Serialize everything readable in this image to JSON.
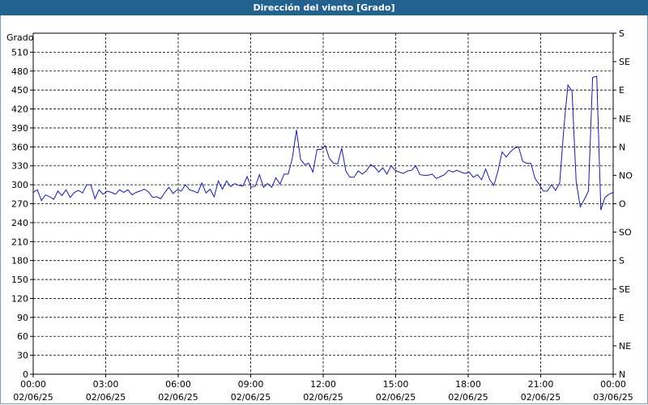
{
  "window": {
    "title": "Dirección del viento [Grado]"
  },
  "chart_data": {
    "type": "line",
    "title": "Dirección del viento [Grado]",
    "ylabel": "Grado",
    "ylim": [
      0,
      540
    ],
    "y_ticks": [
      0,
      30,
      60,
      90,
      120,
      150,
      180,
      210,
      240,
      270,
      300,
      330,
      360,
      390,
      420,
      450,
      480,
      510
    ],
    "right_axis_labels": [
      "N",
      "NE",
      "E",
      "SE",
      "S",
      "SO",
      "O",
      "NO",
      "N",
      "NE",
      "E",
      "SE",
      "S"
    ],
    "right_axis_values": [
      0,
      45,
      90,
      135,
      180,
      225,
      270,
      315,
      360,
      405,
      450,
      495,
      540
    ],
    "x_ticks": [
      {
        "time": "00:00",
        "date": "02/06/25"
      },
      {
        "time": "03:00",
        "date": "02/06/25"
      },
      {
        "time": "06:00",
        "date": "02/06/25"
      },
      {
        "time": "09:00",
        "date": "02/06/25"
      },
      {
        "time": "12:00",
        "date": "02/06/25"
      },
      {
        "time": "15:00",
        "date": "02/06/25"
      },
      {
        "time": "18:00",
        "date": "02/06/25"
      },
      {
        "time": "21:00",
        "date": "02/06/25"
      },
      {
        "time": "00:00",
        "date": "03/06/25"
      }
    ],
    "grid": true,
    "series": [
      {
        "color": "#1a1aaa",
        "x_hours": [
          0,
          0.2,
          0.4,
          0.6,
          0.8,
          1,
          1.2,
          1.4,
          1.6,
          1.8,
          2,
          2.1,
          2.3,
          2.5,
          2.7,
          2.9,
          3,
          3.2,
          3.4,
          3.6,
          3.8,
          4,
          4.2,
          4.4,
          4.6,
          4.8,
          5,
          5.2,
          5.4,
          5.6,
          5.8,
          6,
          6.2,
          6.4,
          6.6,
          6.8,
          7,
          7.2,
          7.4,
          7.6,
          7.8,
          8,
          8.2,
          8.4,
          8.6,
          8.8,
          9,
          9.2,
          9.4,
          9.6,
          9.8,
          10,
          10.2,
          10.4,
          10.6,
          10.8,
          11,
          11.2,
          11.4,
          11.6,
          11.8,
          12,
          12.2,
          12.4,
          12.6,
          12.8,
          13,
          13.2,
          13.4,
          13.6,
          13.8,
          14,
          14.2,
          14.4,
          14.6,
          14.8,
          15,
          15.2,
          15.4,
          15.6,
          15.8,
          16,
          16.2,
          16.4,
          16.6,
          16.8,
          17,
          17.2,
          17.4,
          17.6,
          17.8,
          18,
          18.2,
          18.4,
          18.6,
          18.8,
          19,
          19.2,
          19.4,
          19.6,
          19.8,
          20,
          20.2,
          20.4,
          20.6,
          20.8,
          21,
          21.2,
          21.4,
          21.6,
          21.8,
          22,
          22.2,
          22.4,
          22.6,
          22.8,
          23,
          23.2,
          23.4,
          23.6,
          23.8,
          24
        ],
        "values": [
          288,
          292,
          275,
          284,
          281,
          277,
          290,
          283,
          292,
          280,
          288,
          291,
          287,
          300,
          300,
          278,
          292,
          285,
          290,
          288,
          285,
          292,
          288,
          292,
          284,
          288,
          290,
          293,
          289,
          280,
          281,
          278,
          288,
          296,
          286,
          292,
          290,
          300,
          292,
          290,
          287,
          303,
          287,
          293,
          281,
          306,
          293,
          306,
          297,
          302,
          299,
          298,
          313,
          296,
          298,
          316,
          296,
          302,
          296,
          311,
          301,
          317,
          317,
          342,
          387,
          340,
          332,
          334,
          320,
          356,
          356,
          362,
          342,
          334,
          333,
          358,
          322,
          312,
          312,
          322,
          317,
          322,
          332,
          328,
          320,
          327,
          317,
          330,
          323,
          320,
          318,
          322,
          323,
          330,
          316,
          315,
          315,
          317,
          310,
          313,
          316,
          323,
          320,
          323,
          320,
          318,
          320,
          312,
          316,
          308,
          325,
          308,
          299,
          322,
          352,
          344,
          352,
          358,
          360,
          337,
          334,
          334,
          310,
          301,
          290,
          290,
          300,
          291,
          303,
          390,
          458,
          448,
          305,
          265,
          277,
          290,
          470,
          472,
          260,
          280,
          285,
          288
        ]
      }
    ]
  }
}
